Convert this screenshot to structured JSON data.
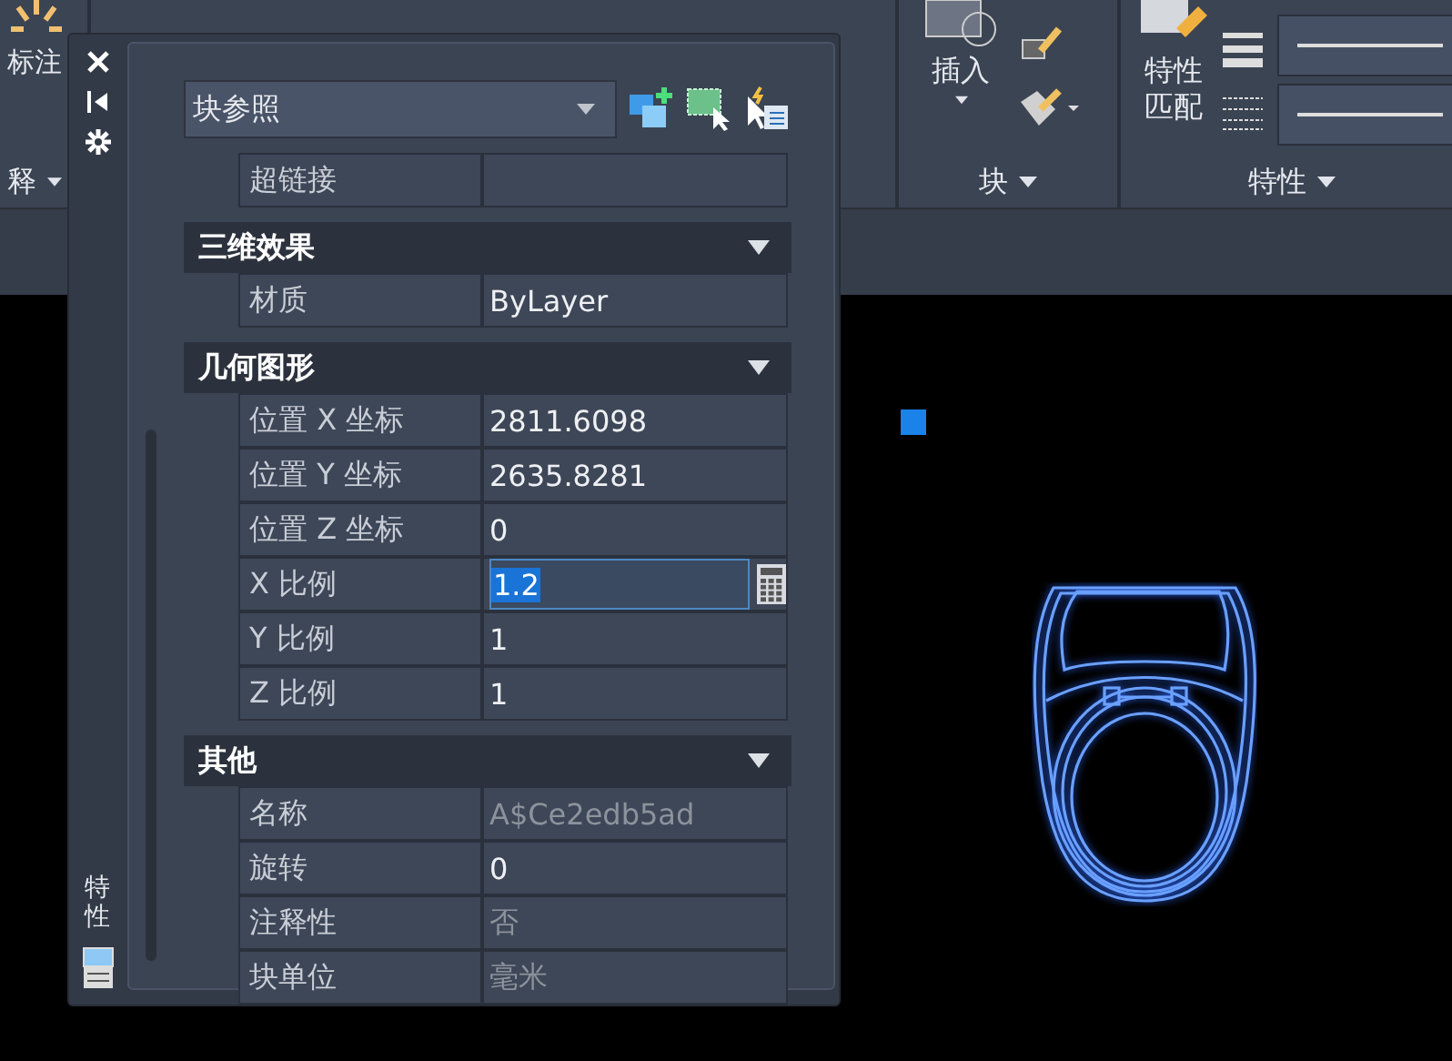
{
  "ribbon": {
    "panels": [
      {
        "title": "释",
        "buttons": [
          {
            "label": "标注"
          }
        ]
      },
      {
        "title": "块",
        "buttons": [
          {
            "label": "插入"
          }
        ]
      },
      {
        "title": "特性",
        "buttons": [
          {
            "label": "特性匹配"
          }
        ]
      }
    ]
  },
  "properties_palette": {
    "sidebar_title": "特性",
    "object_type": "块参照",
    "top_rows": [
      {
        "label": "超链接",
        "kind": "editable"
      }
    ],
    "sections": [
      {
        "title": "三维效果",
        "expanded": true,
        "rows": [
          {
            "label": "材质",
            "value": "ByLayer",
            "kind": "editable"
          }
        ]
      },
      {
        "title": "几何图形",
        "expanded": true,
        "rows": [
          {
            "label": "位置 X 坐标",
            "value": "2811.6098",
            "kind": "editable"
          },
          {
            "label": "位置 Y 坐标",
            "value": "2635.8281",
            "kind": "editable"
          },
          {
            "label": "位置 Z 坐标",
            "value": "0",
            "kind": "editable"
          },
          {
            "label": "X 比例",
            "value": "1.2",
            "kind": "active"
          },
          {
            "label": "Y 比例",
            "value": "1",
            "kind": "editable"
          },
          {
            "label": "Z 比例",
            "value": "1",
            "kind": "editable"
          }
        ]
      },
      {
        "title": "其他",
        "expanded": true,
        "rows": [
          {
            "label": "名称",
            "value": "A$Ce2edb5ad",
            "kind": "readonly"
          },
          {
            "label": "旋转",
            "value": "0",
            "kind": "editable"
          },
          {
            "label": "注释性",
            "value": "否",
            "kind": "readonly"
          },
          {
            "label": "块单位",
            "value": "毫米",
            "kind": "readonly"
          }
        ]
      }
    ]
  }
}
